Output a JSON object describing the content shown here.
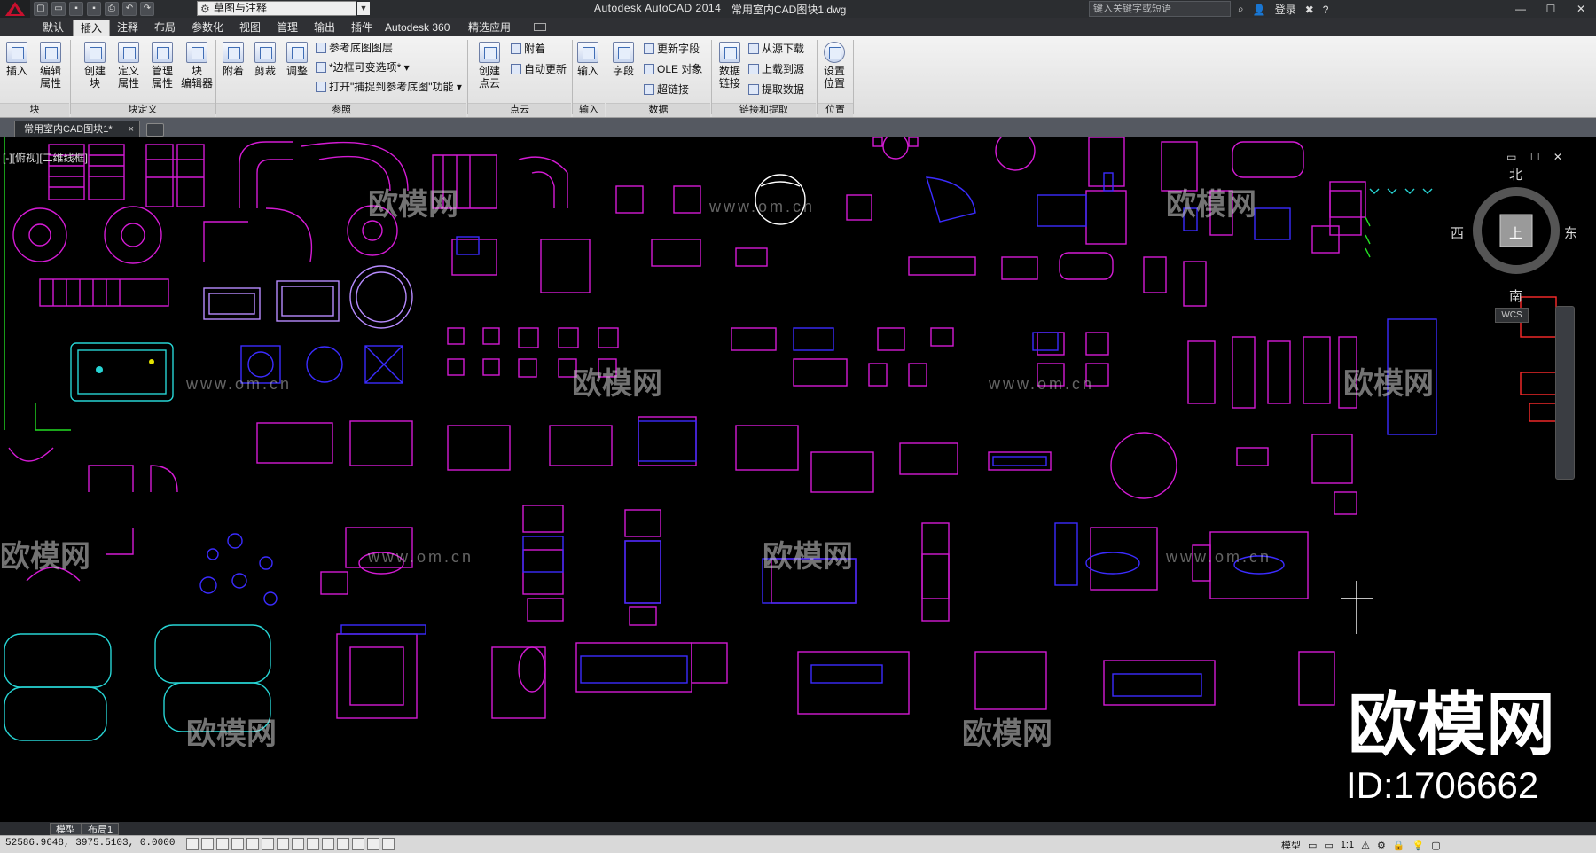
{
  "titlebar": {
    "app_title": "Autodesk AutoCAD 2014",
    "file_title": "常用室内CAD图块1.dwg",
    "workspace": "草图与注释",
    "search_placeholder": "键入关键字或短语",
    "login": "登录",
    "help": "?"
  },
  "ribbon_tabs": [
    "默认",
    "插入",
    "注释",
    "布局",
    "参数化",
    "视图",
    "管理",
    "输出",
    "插件",
    "Autodesk 360",
    "精选应用"
  ],
  "active_tab": "插入",
  "ribbon": {
    "block_panel": {
      "label": "块",
      "buttons": [
        "插入",
        "编辑\n属性"
      ]
    },
    "block_def_panel": {
      "label": "块定义",
      "buttons": [
        "创建\n块",
        "定义\n属性",
        "管理\n属性",
        "块\n编辑器"
      ]
    },
    "reference_panel": {
      "label": "参照",
      "buttons": [
        "附着",
        "剪裁",
        "调整"
      ],
      "rows": [
        "参考底图图层",
        "*边框可变选项*",
        "打开\"捕捉到参考底图\"功能"
      ]
    },
    "pointcloud_panel": {
      "label": "点云",
      "buttons": [
        "创建\n点云"
      ],
      "rows": [
        "附着",
        "自动更新"
      ]
    },
    "import_panel": {
      "label": "输入",
      "buttons": [
        "输入"
      ]
    },
    "data_panel": {
      "label": "数据",
      "buttons": [
        "字段"
      ],
      "rows": [
        "更新字段",
        "OLE 对象",
        "超链接"
      ]
    },
    "link_panel": {
      "label": "链接和提取",
      "buttons": [
        "数据\n链接"
      ],
      "rows": [
        "从源下载",
        "上载到源",
        "提取数据"
      ]
    },
    "location_panel": {
      "label": "位置",
      "buttons": [
        "设置\n位置"
      ]
    }
  },
  "doc_tab": "常用室内CAD图块1*",
  "viewport_label": "[-][俯视][二维线框]",
  "navcube": {
    "north": "北",
    "south": "南",
    "east": "东",
    "west": "西",
    "top": "上",
    "wcs": "WCS"
  },
  "watermark": {
    "text": "欧模网",
    "url": "www.om.cn"
  },
  "brand": {
    "name": "欧模网",
    "id": "ID:1706662"
  },
  "layout_tabs": [
    "模型",
    "布局1"
  ],
  "status": {
    "coords": "52586.9648, 3975.5103, 0.0000",
    "model": "模型",
    "scale": "1:1"
  },
  "colors": {
    "magenta": "#d41bd4",
    "blue": "#3b2cff",
    "cyan": "#27d4d4",
    "green": "#22dd22",
    "background": "#000000"
  }
}
